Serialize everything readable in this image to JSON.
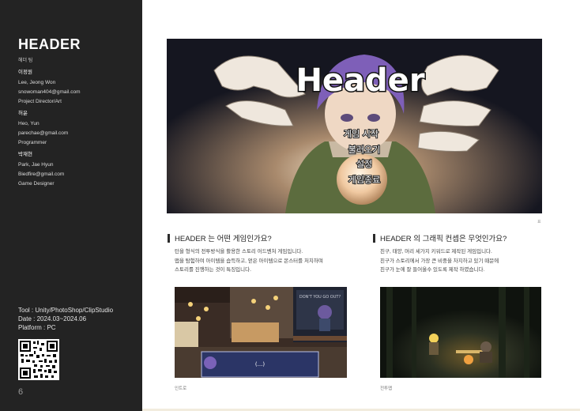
{
  "sidebar": {
    "title": "HEADER",
    "subtitle": "헤더 팀",
    "members": [
      {
        "korean_name": "이정원",
        "name": "Lee, Jeong Won",
        "email": "snowoman404@gmail.com",
        "role": "Project Director/Art"
      },
      {
        "korean_name": "허윤",
        "name": "Heo, Yun",
        "email": "parechae@gmail.com",
        "role": "Programmer"
      },
      {
        "korean_name": "박재현",
        "name": "Park, Jae Hyun",
        "email": "Biedfire@gmail.com",
        "role": "Game Designer"
      }
    ],
    "tool": "Tool : Unity/PhotoShop/ClipStudio",
    "date": "Date : 2024.03~2024.06",
    "platform": "Platform : PC",
    "page_number": "6"
  },
  "hero": {
    "logo": "Header",
    "menu": [
      "게임 시작",
      "불러오기",
      "설정",
      "게임종료"
    ],
    "caption": "표"
  },
  "section1": {
    "title": "HEADER 는 어떤 게임인가요?",
    "body": [
      "턴을 형식의 전투방식을 활용한 스토리 어드벤처 게임입니다.",
      "맵을 탐험하여 아이템을 습득하고, 얻은 아이템으로 몬스터를 처치하며",
      "스토리를 진행하는 것이 특징입니다."
    ],
    "caption": "인트로",
    "dialog_text": "(...)",
    "window_text": "DON'T YOU GO OUT?"
  },
  "section2": {
    "title": "HEADER 의 그래픽 컨셉은 무엇인가요?",
    "body": [
      "친구, 태양, 머리 세가지 키워드로 제작된 게임입니다.",
      "친구가 스토리에서 가장 큰 비중을 차지하고 있기 때문에",
      "친구가 눈에 잘 들어올수 있도록 제작 하였습니다."
    ],
    "caption": "전투맵"
  },
  "colors": {
    "sidebar_bg": "#232323",
    "accent_bar": "#2b2b2b"
  }
}
